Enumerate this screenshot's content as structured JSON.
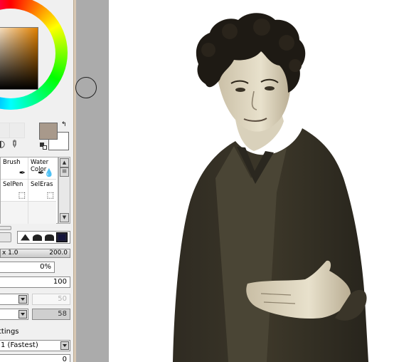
{
  "tools": {
    "brush": "Brush",
    "water_color": [
      "Water",
      "Color"
    ],
    "selpen": "SelPen",
    "seleras": "SelEras"
  },
  "colors": {
    "primary": "#a8998b",
    "secondary": "#ffffff",
    "canvas_bg": "#ffffff",
    "gutter": "#ababab"
  },
  "brush_settings": {
    "size_multiplier": "x 1.0",
    "size": "200.0",
    "density_percent": "0%",
    "opacity": "100",
    "blending_value": "50",
    "dilution_value": "58",
    "advanced_settings_label": "ttings",
    "quality": "1 (Fastest)",
    "edge_value": "0"
  },
  "icons": {
    "swap": "swap-arrow-icon",
    "reset": "reset-colors-icon",
    "eyedropper": "eyedropper-icon",
    "dropper": "dropper-icon"
  }
}
